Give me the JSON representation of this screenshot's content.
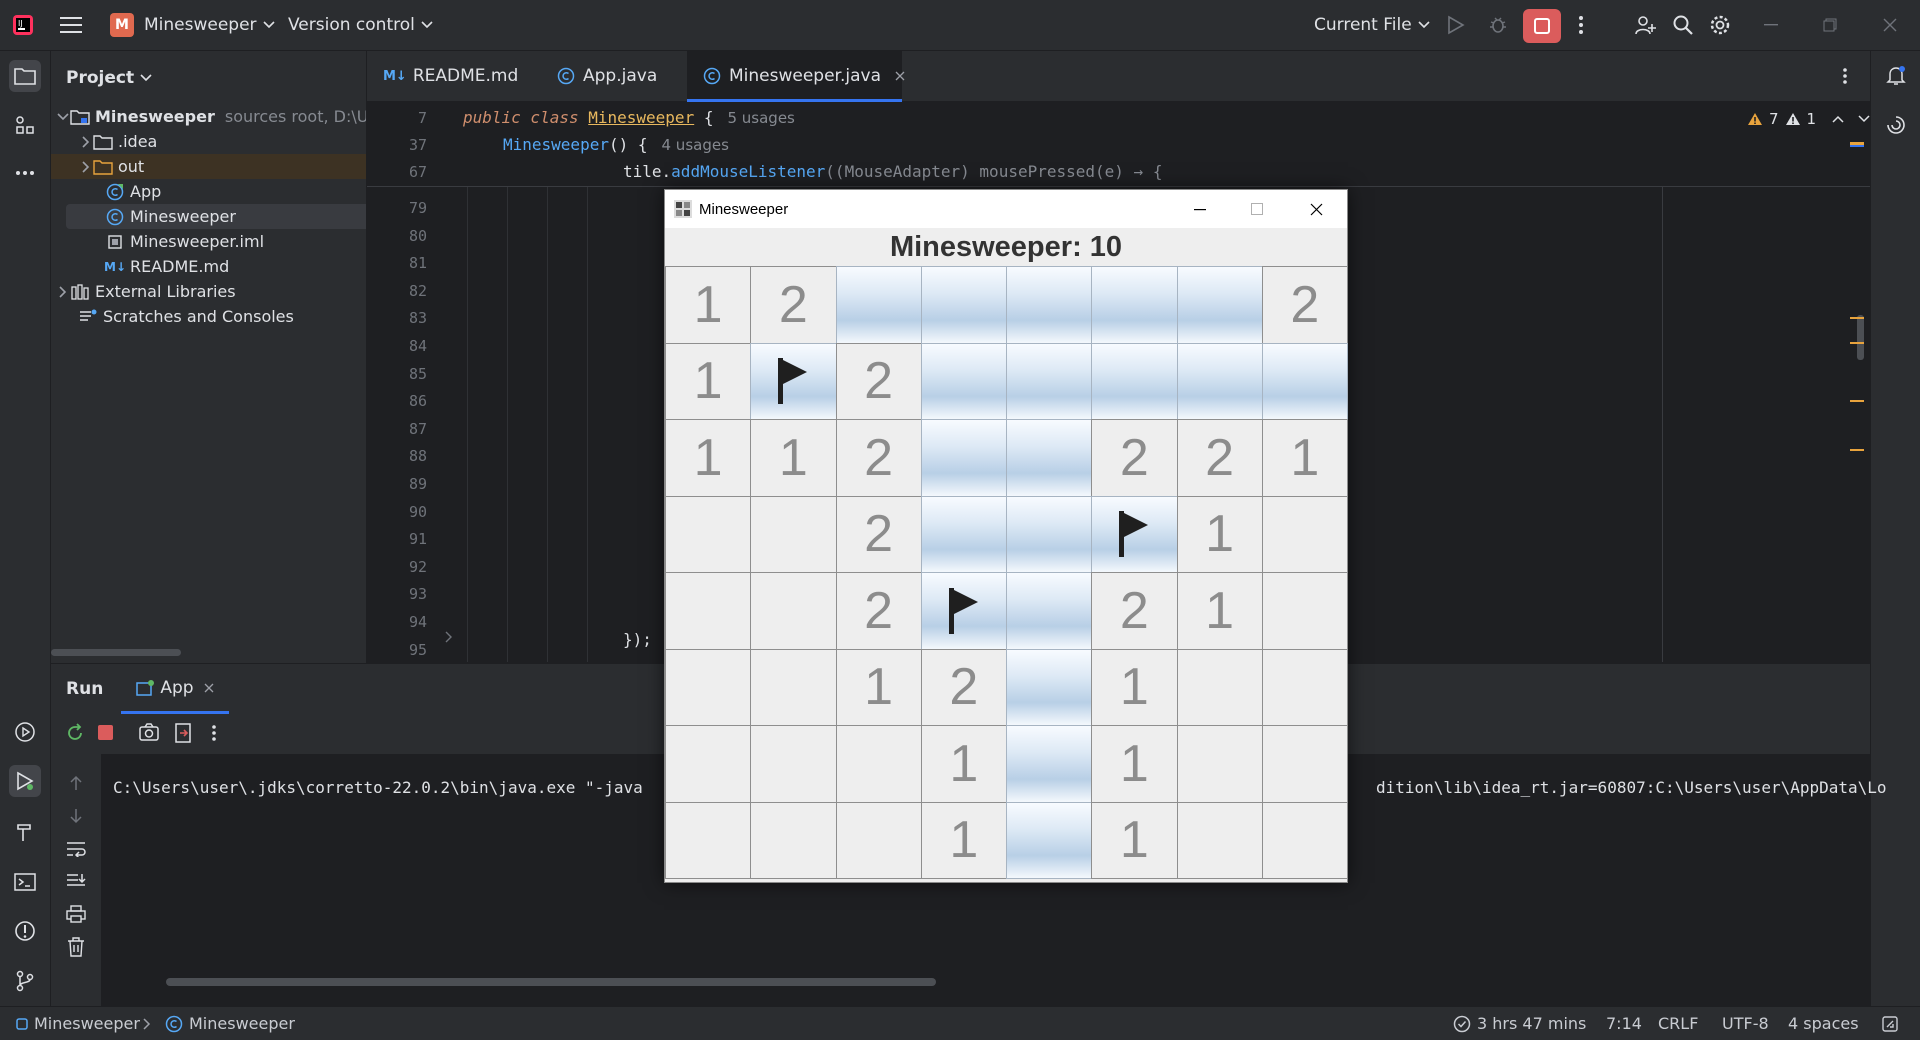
{
  "titlebar": {
    "project_badge": "M",
    "project_name": "Minesweeper",
    "version_control": "Version control",
    "run_config": "Current File"
  },
  "project_panel": {
    "title": "Project",
    "items": [
      {
        "label": "Minesweeper",
        "hint": "sources root,  D:\\U"
      },
      {
        "label": ".idea"
      },
      {
        "label": "out"
      },
      {
        "label": "App"
      },
      {
        "label": "Minesweeper"
      },
      {
        "label": "Minesweeper.iml"
      },
      {
        "label": "README.md"
      },
      {
        "label": "External Libraries"
      },
      {
        "label": "Scratches and Consoles"
      }
    ]
  },
  "editor": {
    "tabs": [
      {
        "label": "README.md"
      },
      {
        "label": "App.java"
      },
      {
        "label": "Minesweeper.java"
      }
    ],
    "inspections": {
      "warnings": "7",
      "weak_warnings": "1"
    },
    "sticky_lines": [
      {
        "num": "7",
        "kw": "public class ",
        "name": "Minesweeper",
        "rest": " {",
        "usage": "5 usages"
      },
      {
        "num": "37",
        "kw": "",
        "name": "Minesweeper",
        "rest": "() {",
        "usage": "4 usages"
      },
      {
        "num": "67",
        "pre": "tile.",
        "fn": "addMouseListener",
        "rest": "((MouseAdapter) mousePressed(e) → {"
      }
    ],
    "line_numbers": [
      "79",
      "80",
      "81",
      "82",
      "83",
      "84",
      "85",
      "86",
      "87",
      "88",
      "89",
      "90",
      "91",
      "92",
      "93",
      "94",
      "95"
    ],
    "closing_code": "});"
  },
  "run_panel": {
    "tab_run": "Run",
    "tab_app": "App",
    "console_left": "C:\\Users\\user\\.jdks\\corretto-22.0.2\\bin\\java.exe \"-java",
    "console_right": "dition\\lib\\idea_rt.jar=60807:C:\\Users\\user\\AppData\\Lo"
  },
  "statusbar": {
    "crumb1": "Minesweeper",
    "crumb2": "Minesweeper",
    "time_tracked": "3 hrs 47 mins",
    "position": "7:14",
    "line_sep": "CRLF",
    "encoding": "UTF-8",
    "indent": "4 spaces"
  },
  "minesweeper": {
    "window_title": "Minesweeper",
    "heading": "Minesweeper: 10",
    "board": [
      [
        "1",
        "2",
        "#",
        "#",
        "#",
        "#",
        "#",
        "2"
      ],
      [
        "1",
        "F",
        "2",
        "#",
        "#",
        "#",
        "#",
        "#"
      ],
      [
        "1",
        "1",
        "2",
        "#",
        "#",
        "2",
        "2",
        "1"
      ],
      [
        "",
        "",
        "2",
        "#",
        "#",
        "F",
        "1",
        ""
      ],
      [
        "",
        "",
        "2",
        "F",
        "#",
        "2",
        "1",
        ""
      ],
      [
        "",
        "",
        "1",
        "2",
        "#",
        "1",
        "",
        ""
      ],
      [
        "",
        "",
        "",
        "1",
        "#",
        "1",
        "",
        ""
      ],
      [
        "",
        "",
        "",
        "1",
        "#",
        "1",
        "",
        ""
      ]
    ]
  },
  "icons": {
    "flag": "flag-icon",
    "folder": "folder-icon",
    "class": "class-icon"
  },
  "colors": {
    "accent": "#3574f0",
    "stop": "#db5c5c",
    "warning": "#e8a33d"
  }
}
